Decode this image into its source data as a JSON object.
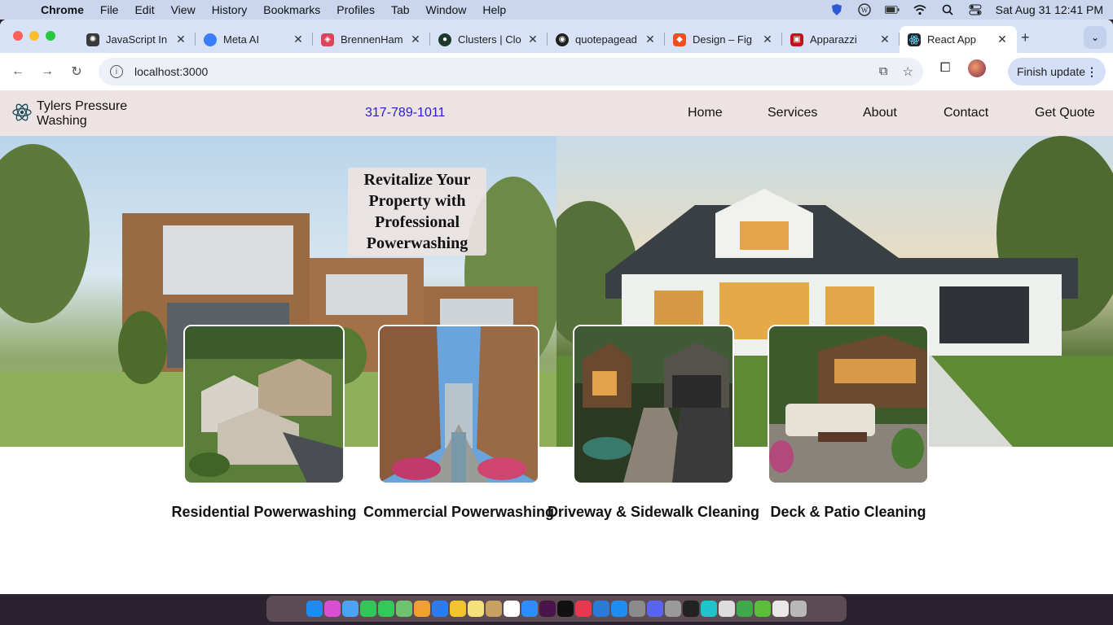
{
  "menubar": {
    "app_name": "Chrome",
    "items": [
      "File",
      "Edit",
      "View",
      "History",
      "Bookmarks",
      "Profiles",
      "Tab",
      "Window",
      "Help"
    ],
    "clock": "Sat Aug 31  12:41 PM"
  },
  "tabs": [
    {
      "label": "JavaScript In",
      "color": "#3a3a3a"
    },
    {
      "label": "Meta AI",
      "color": "#3b7dff"
    },
    {
      "label": "BrennenHam",
      "color": "#e0445b"
    },
    {
      "label": "Clusters | Clo",
      "color": "#1b3a2c"
    },
    {
      "label": "quotepagead",
      "color": "#1f1f1f"
    },
    {
      "label": "Design – Fig",
      "color": "#f24e1e"
    },
    {
      "label": "Apparazzi",
      "color": "#c3101a"
    },
    {
      "label": "React App",
      "color": "#20232a",
      "active": true
    }
  ],
  "toolbar": {
    "url": "localhost:3000",
    "finish_update": "Finish update"
  },
  "site": {
    "brand": "Tylers Pressure Washing",
    "phone": "317-789-1011",
    "nav": [
      "Home",
      "Services",
      "About",
      "Contact",
      "Get Quote"
    ],
    "headline": "Revitalize Your Property with Professional Powerwashing",
    "services": [
      {
        "title": "Residential Powerwashing",
        "photo": "residential-photo"
      },
      {
        "title": "Commercial Powerwashing",
        "photo": "commercial-photo"
      },
      {
        "title": "Driveway & Sidewalk Cleaning",
        "photo": "driveway-photo"
      },
      {
        "title": "Deck & Patio Cleaning",
        "photo": "deck-photo"
      }
    ],
    "phone_color": "#2a1bd4",
    "nav_bg": "#ece3e2"
  }
}
